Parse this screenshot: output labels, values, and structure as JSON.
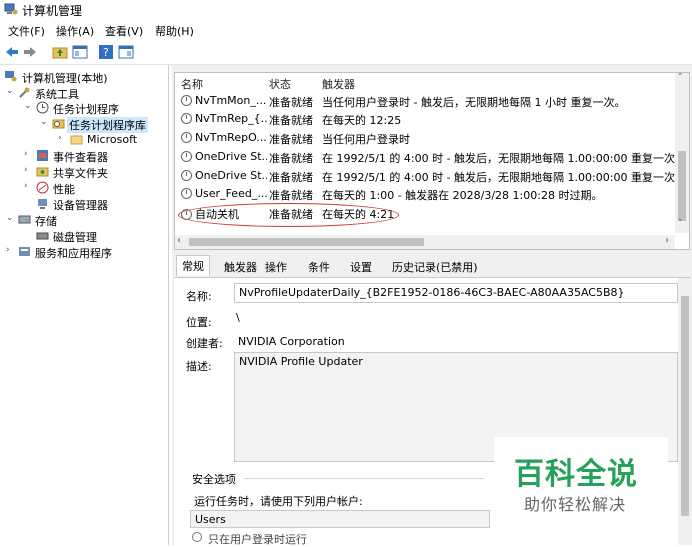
{
  "window": {
    "title": "计算机管理"
  },
  "menu": [
    "文件(F)",
    "操作(A)",
    "查看(V)",
    "帮助(H)"
  ],
  "tree": {
    "root": "计算机管理(本地)",
    "system_tools": "系统工具",
    "task_scheduler": "任务计划程序",
    "task_scheduler_library": "任务计划程序库",
    "microsoft": "Microsoft",
    "event_viewer": "事件查看器",
    "shared_folders": "共享文件夹",
    "performance": "性能",
    "device_manager": "设备管理器",
    "storage": "存储",
    "disk_management": "磁盘管理",
    "services_apps": "服务和应用程序"
  },
  "task_list": {
    "columns": [
      "名称",
      "状态",
      "触发器"
    ],
    "rows": [
      {
        "name": "NvTmMon_...",
        "status": "准备就绪",
        "trigger": "当任何用户登录时 - 触发后，无限期地每隔 1 小时 重复一次。"
      },
      {
        "name": "NvTmRep_{...",
        "status": "准备就绪",
        "trigger": "在每天的 12:25"
      },
      {
        "name": "NvTmRepO...",
        "status": "准备就绪",
        "trigger": "当任何用户登录时"
      },
      {
        "name": "OneDrive St...",
        "status": "准备就绪",
        "trigger": "在 1992/5/1 的 4:00 时 - 触发后，无限期地每隔 1.00:00:00 重复一次。"
      },
      {
        "name": "OneDrive St...",
        "status": "准备就绪",
        "trigger": "在 1992/5/1 的 4:00 时 - 触发后，无限期地每隔 1.00:00:00 重复一次。"
      },
      {
        "name": "User_Feed_...",
        "status": "准备就绪",
        "trigger": "在每天的 1:00 - 触发器在 2028/3/28 1:00:28 时过期。"
      },
      {
        "name": "自动关机",
        "status": "准备就绪",
        "trigger": "在每天的 4:21"
      }
    ]
  },
  "tabs": [
    "常规",
    "触发器",
    "操作",
    "条件",
    "设置",
    "历史记录(已禁用)"
  ],
  "general": {
    "name_label": "名称:",
    "name_value": "NvProfileUpdaterDaily_{B2FE1952-0186-46C3-BAEC-A80AA35AC5B8}",
    "location_label": "位置:",
    "location_value": "\\",
    "author_label": "创建者:",
    "author_value": "NVIDIA Corporation",
    "desc_label": "描述:",
    "desc_value": "NVIDIA Profile Updater",
    "security_title": "安全选项",
    "run_as_label": "运行任务时，请使用下列用户帐户:",
    "user_value": "Users",
    "radio_label": "只在用户登录时运行"
  },
  "watermark": {
    "title": "百科全说",
    "subtitle": "助你轻松解决"
  },
  "colors": {
    "accent_ellipse": "#d0393b",
    "watermark_green": "#27a15a",
    "selection": "#cce8ff"
  }
}
